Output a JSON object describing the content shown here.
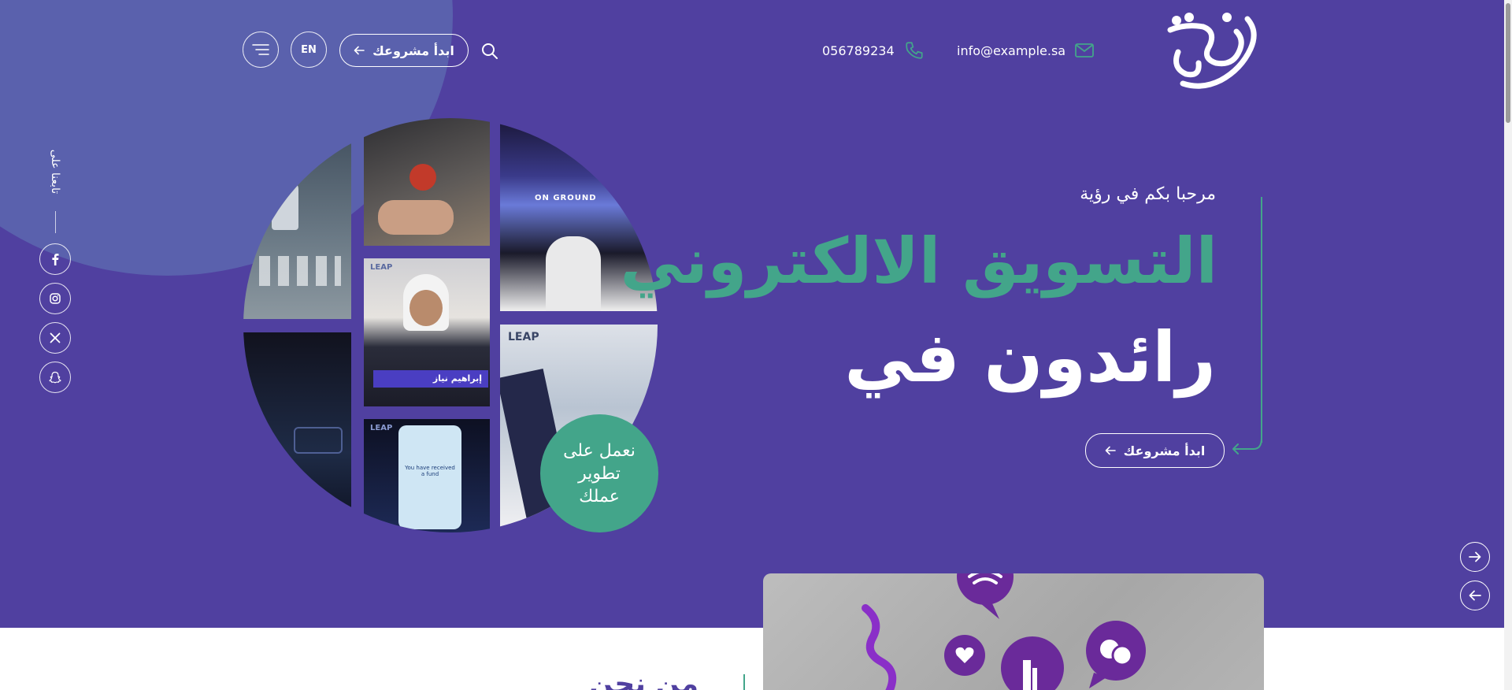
{
  "header": {
    "email": "info@example.sa",
    "phone": "056789234",
    "cta_label": "ابدأ مشروعك",
    "lang_label": "EN"
  },
  "social": {
    "follow_label": "تابعنا على",
    "items": [
      "facebook",
      "instagram",
      "x",
      "snapchat"
    ]
  },
  "hero": {
    "welcome": "مرحبا بكم في رؤية",
    "headline_line1": "التسويق الالكتروني",
    "headline_line2": "رائدون في",
    "cta_label": "ابدأ مشروعك",
    "badge_lines": [
      "نعمل على",
      "تطوير",
      "عملك"
    ],
    "tile_captions": {
      "speaker_name": "إبراهيم نياز",
      "event_logo": "LEAP",
      "screen_text": "ON GROUND",
      "phone_text": "You have received a fund"
    }
  },
  "about": {
    "title": "من نحن"
  },
  "colors": {
    "primary": "#5040a0",
    "accent": "#43a58a",
    "blob": "#5a61ad"
  }
}
